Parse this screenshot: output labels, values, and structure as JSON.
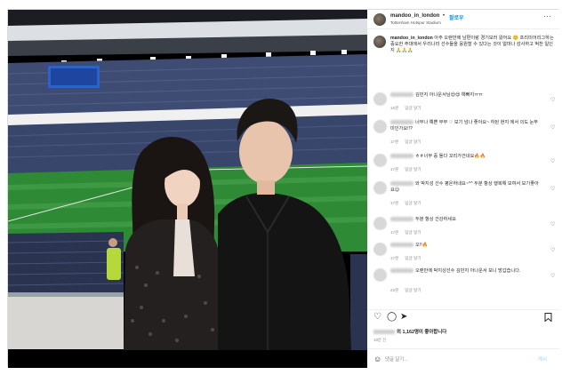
{
  "post": {
    "username": "mandoo_in_london",
    "separator": "•",
    "follow_label": "팔로우",
    "location": "Tottenham Hotspur Stadium",
    "more_icon": "more-horizontal-icon",
    "caption_username": "mandoo_in_london",
    "caption_text": "아주 오랜만에 남편이랑 경기보러 왔어요 ☺️ 프리미어리그하는 중요한 주대에서 우리나라 선수들을 응원할 수 있다는 것이 얼마나 감사하고 벅찬 일인지 🙏🙏🙏",
    "comments": [
      {
        "text": "김민지 아나운서님😍😍 예뻐지ㅠㅠ",
        "time": "15분",
        "reply": "답글 달기"
      },
      {
        "text": "너무나 예쁜 부부 ♡ 보기 넘나 좋아요~ 하된 현지 에서 의도 눈뚜미인가요!!?",
        "time": "17분",
        "reply": "답글 달기"
      },
      {
        "text": "ㅎㅎ너무 중 돌다 꼬리가건네요🔥🔥",
        "time": "17분",
        "reply": "답글 달기"
      },
      {
        "text": "와 박지성 선수 평온하네요~^^ 두분 항상 행복해 보여서 보기좋아요😊",
        "time": "17분",
        "reply": "답글 달기"
      },
      {
        "text": "두분 항상 건강하세요",
        "time": "17분",
        "reply": "답글 달기"
      },
      {
        "text": "오!!🔥",
        "time": "17분",
        "reply": "답글 달기"
      },
      {
        "text": "오랜만에 박지성선수 김민지 아나운서 보니 방갑습니다.",
        "time": "22분",
        "reply": "답글 달기"
      }
    ],
    "likes_suffix": "외 1,162명이 좋아합니다",
    "date": "18분 전",
    "comment_placeholder": "댓글 달기...",
    "post_button": "게시"
  },
  "icons": {
    "like": "heart-icon",
    "comment": "comment-icon",
    "share": "share-icon",
    "save": "bookmark-icon",
    "emoji": "emoji-icon"
  },
  "colors": {
    "accent": "#0095f6",
    "border": "#dbdbdb",
    "muted": "#8e8e8e"
  }
}
